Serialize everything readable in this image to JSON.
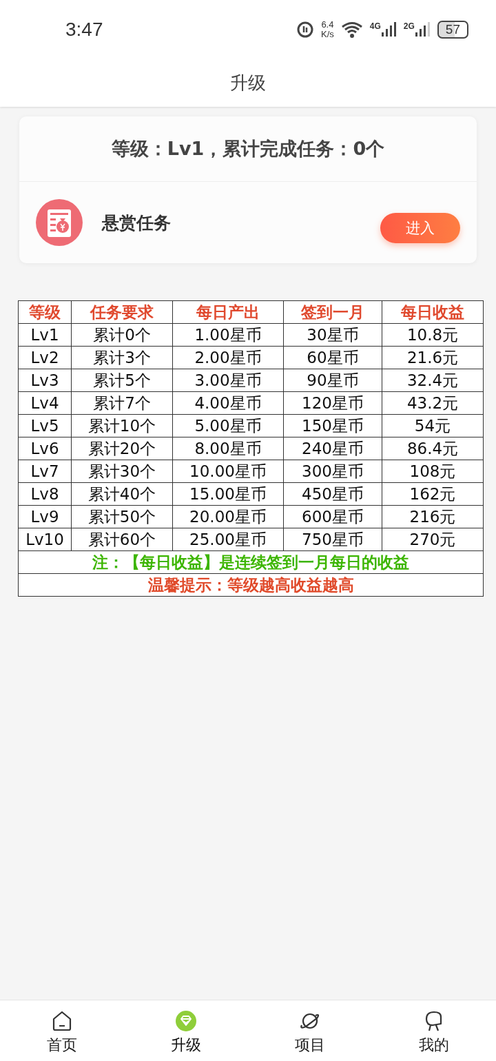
{
  "status_bar": {
    "time": "3:47",
    "speed_value": "6.4",
    "speed_unit": "K/s",
    "network_1": "4G",
    "network_2": "2G",
    "battery": "57"
  },
  "header": {
    "title": "升级"
  },
  "summary": {
    "text": "等级：Lv1，累计完成任务：0个"
  },
  "task": {
    "title": "悬赏任务",
    "button": "进入"
  },
  "table": {
    "columns": [
      "等级",
      "任务要求",
      "每日产出",
      "签到一月",
      "每日收益"
    ],
    "rows": [
      [
        "Lv1",
        "累计0个",
        "1.00星币",
        "30星币",
        "10.8元"
      ],
      [
        "Lv2",
        "累计3个",
        "2.00星币",
        "60星币",
        "21.6元"
      ],
      [
        "Lv3",
        "累计5个",
        "3.00星币",
        "90星币",
        "32.4元"
      ],
      [
        "Lv4",
        "累计7个",
        "4.00星币",
        "120星币",
        "43.2元"
      ],
      [
        "Lv5",
        "累计10个",
        "5.00星币",
        "150星币",
        "54元"
      ],
      [
        "Lv6",
        "累计20个",
        "8.00星币",
        "240星币",
        "86.4元"
      ],
      [
        "Lv7",
        "累计30个",
        "10.00星币",
        "300星币",
        "108元"
      ],
      [
        "Lv8",
        "累计40个",
        "15.00星币",
        "450星币",
        "162元"
      ],
      [
        "Lv9",
        "累计50个",
        "20.00星币",
        "600星币",
        "216元"
      ],
      [
        "Lv10",
        "累计60个",
        "25.00星币",
        "750星币",
        "270元"
      ]
    ],
    "notes": [
      {
        "text": "注：【每日收益】是连续签到一月每日的收益",
        "color": "#3cb500"
      },
      {
        "text": "温馨提示：等级越高收益越高",
        "color": "#e04a2a"
      }
    ]
  },
  "bottom_nav": [
    {
      "label": "首页",
      "kind": "home",
      "selected": false
    },
    {
      "label": "升级",
      "kind": "diamond",
      "selected": true
    },
    {
      "label": "项目",
      "kind": "planet",
      "selected": false
    },
    {
      "label": "我的",
      "kind": "person",
      "selected": false
    }
  ]
}
